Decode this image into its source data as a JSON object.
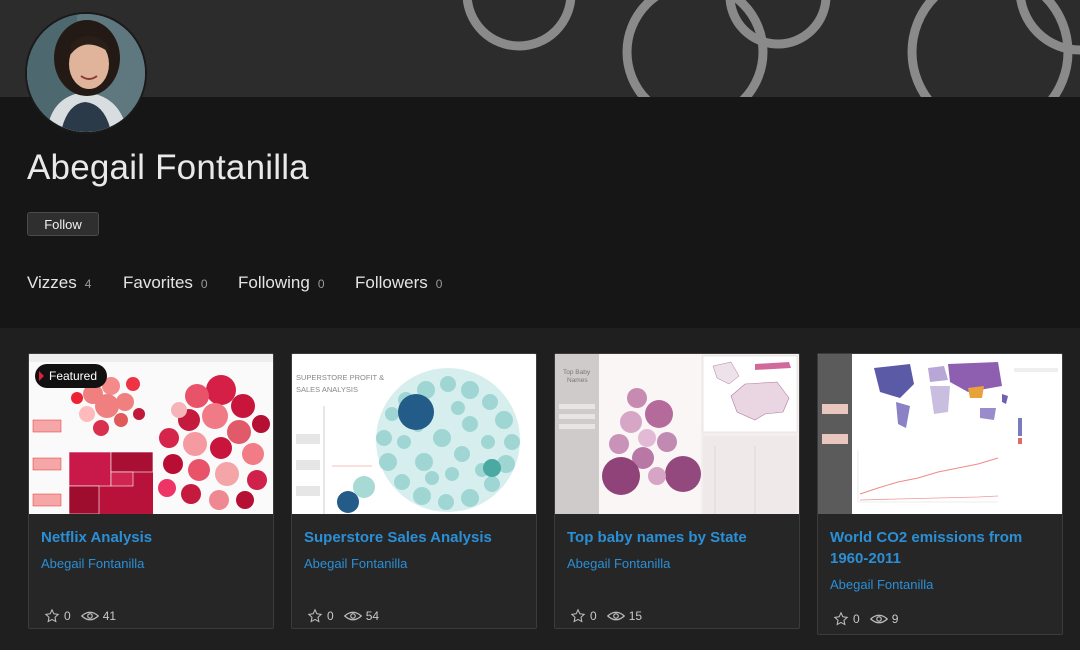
{
  "profile": {
    "name": "Abegail Fontanilla",
    "follow_label": "Follow"
  },
  "stats": [
    {
      "label": "Vizzes",
      "count": "4"
    },
    {
      "label": "Favorites",
      "count": "0"
    },
    {
      "label": "Following",
      "count": "0"
    },
    {
      "label": "Followers",
      "count": "0"
    }
  ],
  "cards": [
    {
      "title": "Netflix Analysis",
      "author": "Abegail Fontanilla",
      "favorites": "0",
      "views": "41",
      "badge": "Featured",
      "thumb_icon": "bubble-treemap-thumbnail-icon"
    },
    {
      "title": "Superstore Sales Analysis",
      "author": "Abegail Fontanilla",
      "favorites": "0",
      "views": "54",
      "thumb_heading": "SUPERSTORE PROFIT & SALES ANALYSIS",
      "thumb_icon": "bubble-cluster-thumbnail-icon"
    },
    {
      "title": "Top baby names by State",
      "author": "Abegail Fontanilla",
      "favorites": "0",
      "views": "15",
      "thumb_heading": "Top Baby Names",
      "thumb_icon": "bubble-map-thumbnail-icon"
    },
    {
      "title": "World CO2 emissions from 1960-2011",
      "author": "Abegail Fontanilla",
      "favorites": "0",
      "views": "9",
      "thumb_icon": "world-map-line-thumbnail-icon"
    }
  ],
  "colors": {
    "link": "#2b8fd6",
    "background": "#1f1f1f",
    "header": "#161616",
    "banner": "#2c2c2c",
    "badge_accent": "#e01f3d"
  },
  "icons": {
    "favorite": "star-outline-icon",
    "views": "eye-icon"
  }
}
